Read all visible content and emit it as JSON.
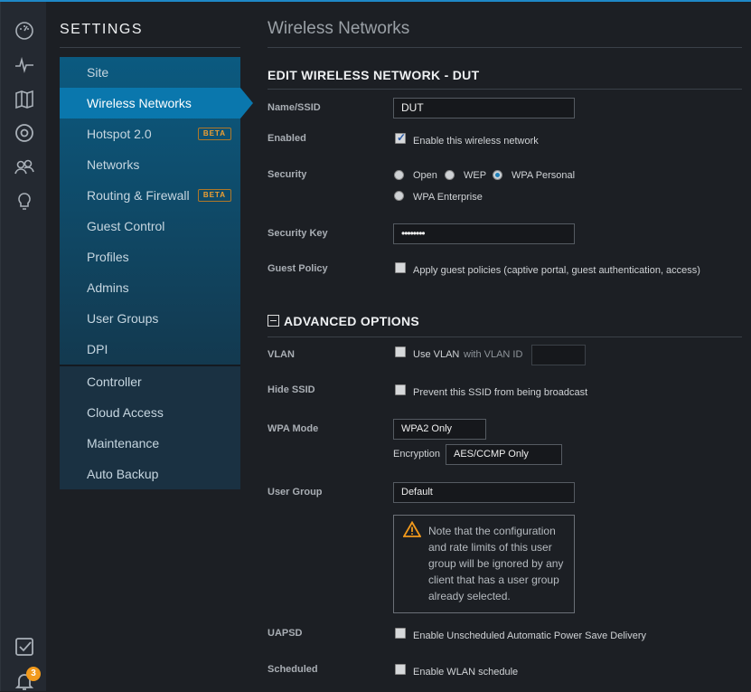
{
  "rail": {
    "items": [
      "dashboard-icon",
      "statistics-icon",
      "map-icon",
      "devices-icon",
      "clients-icon",
      "insights-icon"
    ],
    "bottom": [
      "alerts-icon",
      "notifications-icon"
    ],
    "notification_count": "3"
  },
  "settings": {
    "title": "SETTINGS",
    "nav": [
      {
        "label": "Site"
      },
      {
        "label": "Wireless Networks",
        "active": true
      },
      {
        "label": "Hotspot 2.0",
        "badge": "BETA"
      },
      {
        "label": "Networks"
      },
      {
        "label": "Routing & Firewall",
        "badge": "BETA"
      },
      {
        "label": "Guest Control"
      },
      {
        "label": "Profiles"
      },
      {
        "label": "Admins"
      },
      {
        "label": "User Groups"
      },
      {
        "label": "DPI"
      }
    ],
    "nav2": [
      {
        "label": "Controller"
      },
      {
        "label": "Cloud Access"
      },
      {
        "label": "Maintenance"
      },
      {
        "label": "Auto Backup"
      }
    ]
  },
  "page": {
    "title": "Wireless Networks",
    "section": "EDIT WIRELESS NETWORK - DUT",
    "advanced": "ADVANCED OPTIONS"
  },
  "form": {
    "name_label": "Name/SSID",
    "name_value": "DUT",
    "enabled_label": "Enabled",
    "enabled_text": "Enable this wireless network",
    "enabled": true,
    "security_label": "Security",
    "security_options": [
      "Open",
      "WEP",
      "WPA Personal",
      "WPA Enterprise"
    ],
    "security_selected": "WPA Personal",
    "key_label": "Security Key",
    "key_value": "••••••••",
    "guest_label": "Guest Policy",
    "guest_text": "Apply guest policies (captive portal, guest authentication, access)",
    "vlan_label": "VLAN",
    "vlan_text": "Use VLAN",
    "vlan_id_text": "with VLAN ID",
    "vlan_id_value": "",
    "hide_label": "Hide SSID",
    "hide_text": "Prevent this SSID from being broadcast",
    "wpa_label": "WPA Mode",
    "wpa_value": "WPA2 Only",
    "enc_label": "Encryption",
    "enc_value": "AES/CCMP Only",
    "ug_label": "User Group",
    "ug_value": "Default",
    "note": "Note that the configuration and rate limits of this user group will be ignored by any client that has a user group already selected.",
    "uapsd_label": "UAPSD",
    "uapsd_text": "Enable Unscheduled Automatic Power Save Delivery",
    "sched_label": "Scheduled",
    "sched_text": "Enable WLAN schedule"
  },
  "colors": {
    "accent": "#0a77ad",
    "beta": "#f0a032",
    "warning": "#f29a1c"
  }
}
